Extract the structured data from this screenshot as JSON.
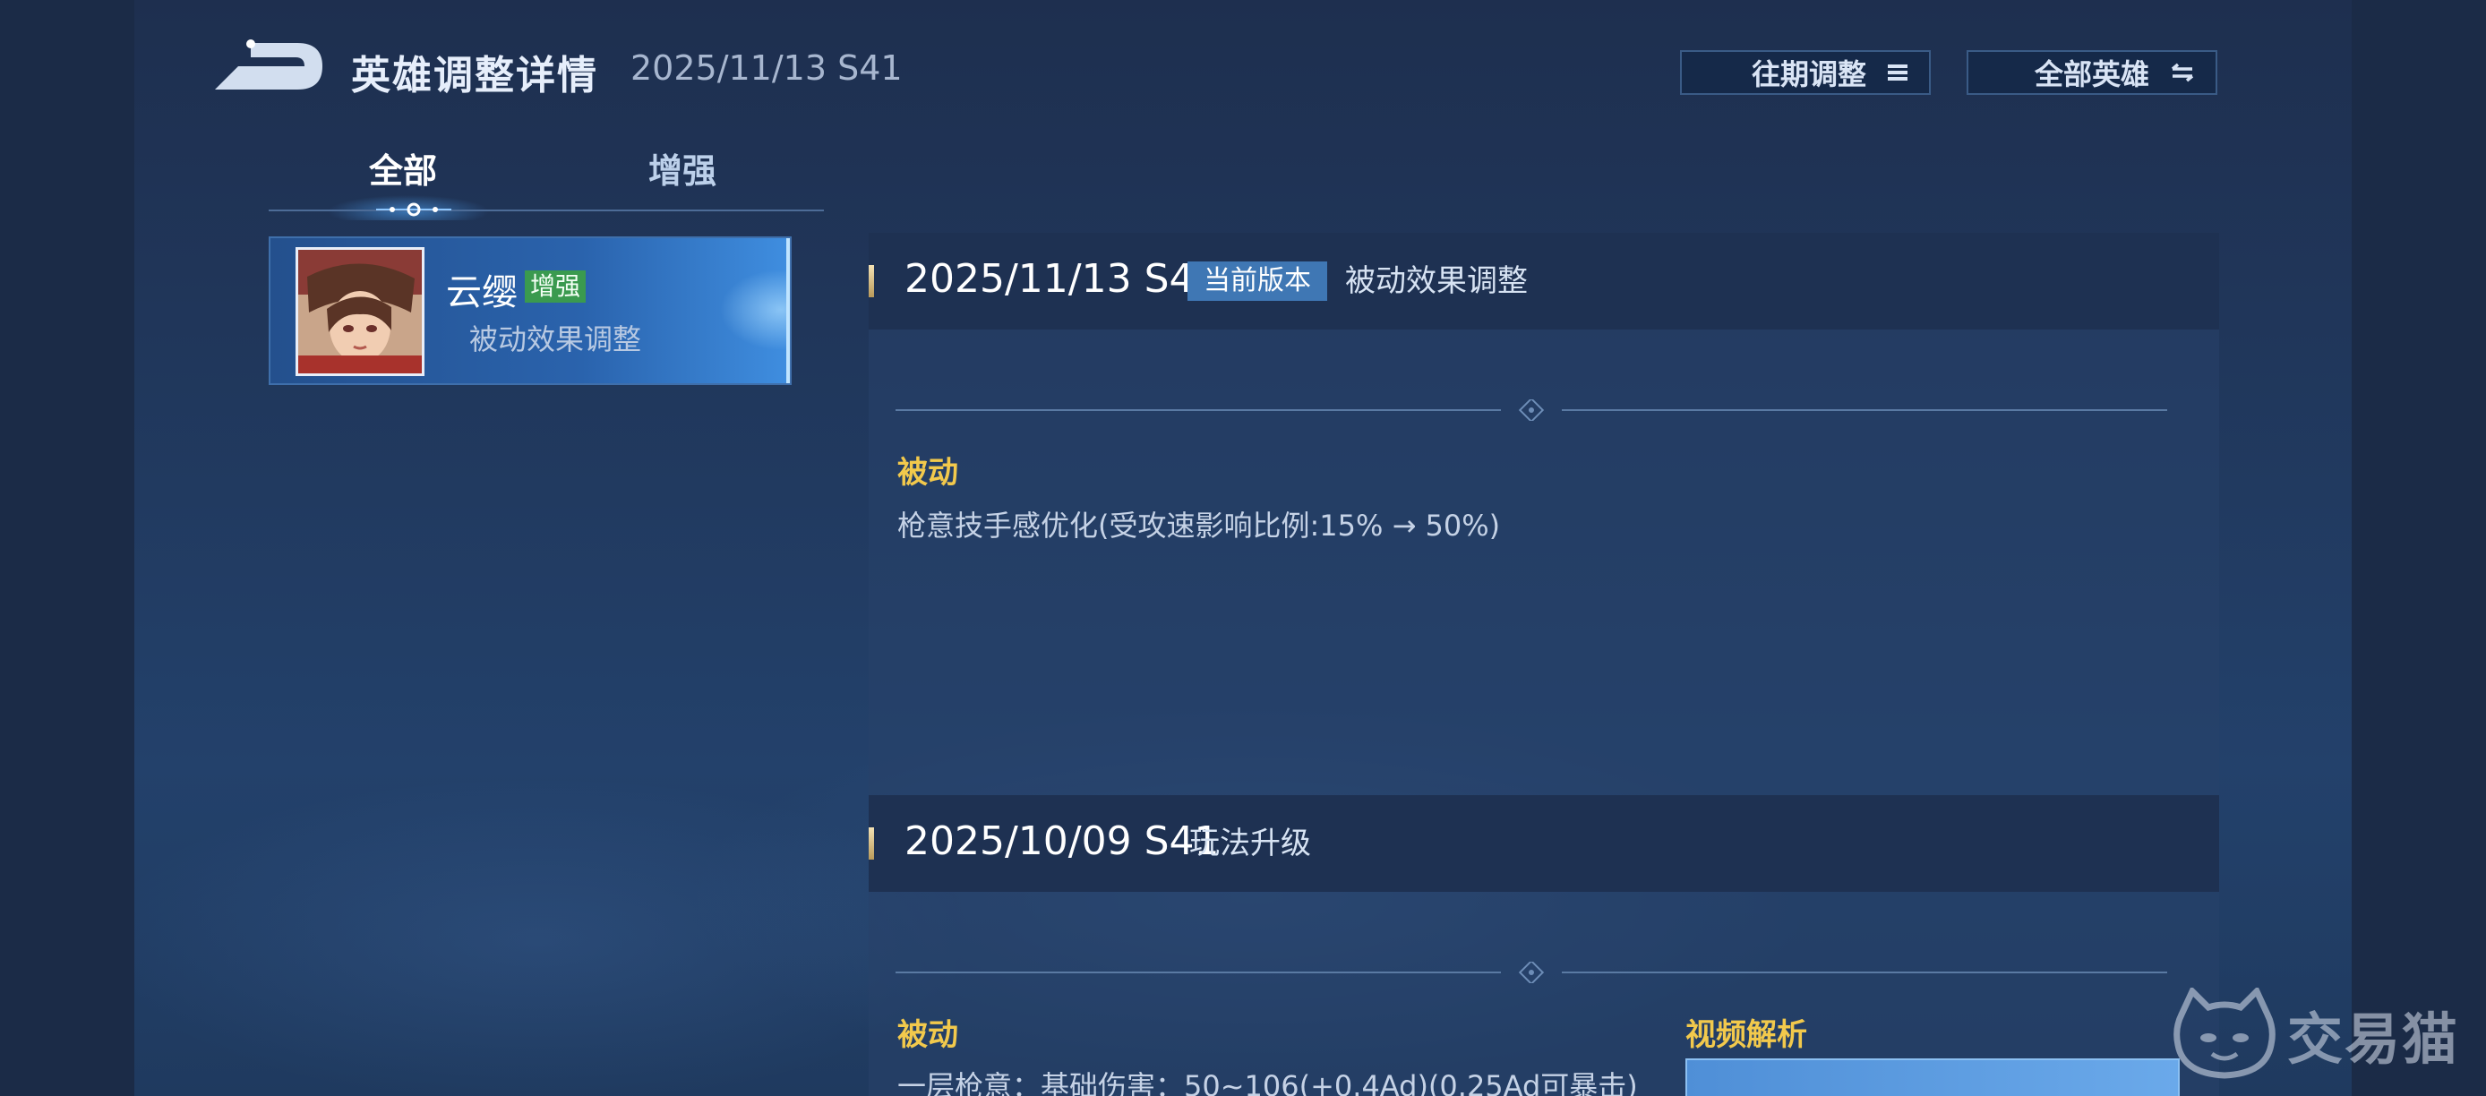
{
  "header": {
    "title": "英雄调整详情",
    "version": "2025/11/13 S41",
    "history_button": "往期调整",
    "all_heroes_button": "全部英雄"
  },
  "tabs": [
    {
      "label": "全部",
      "active": true
    },
    {
      "label": "增强",
      "active": false
    }
  ],
  "hero_list": [
    {
      "name": "云缨",
      "badge": "增强",
      "subtitle": "被动效果调整",
      "selected": true
    }
  ],
  "patches": [
    {
      "date": "2025/11/13 S41",
      "current_badge": "当前版本",
      "description": "被动效果调整",
      "section_title": "被动",
      "section_text": "枪意技手感优化(受攻速影响比例:15% → 50%)"
    },
    {
      "date": "2025/10/09 S41",
      "description": "玩法升级",
      "section_title": "被动",
      "section_text": "一层枪意：基础伤害：50~106(+0.4Ad)(0.25Ad可暴击)",
      "video_title": "视频解析"
    }
  ],
  "watermark": "交易猫",
  "colors": {
    "accent_gold": "#f2c94c",
    "badge_green": "#3a9a4f",
    "current_badge_blue": "#3f77b4",
    "selected_card_blue": "#2a63ad"
  }
}
